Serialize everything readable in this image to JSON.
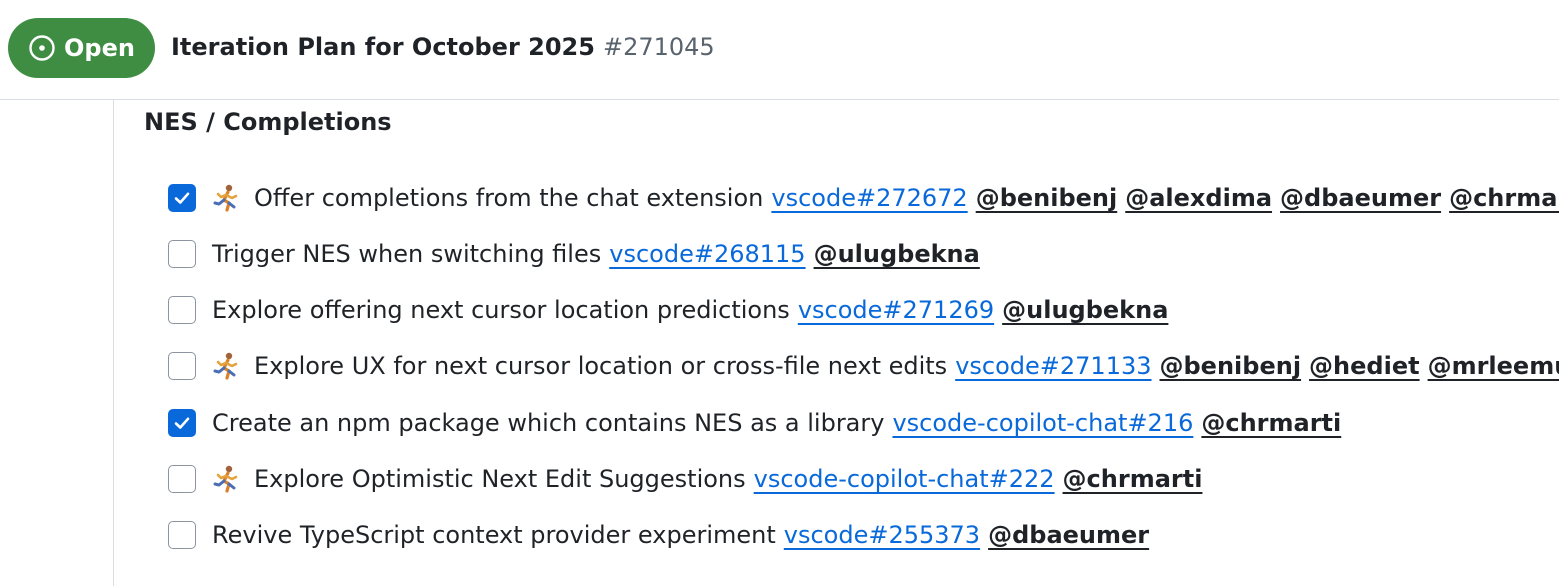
{
  "header": {
    "state_label": "Open",
    "state_icon": "issue-opened-icon",
    "state_color": "#3f8d43",
    "title": "Iteration Plan for October 2025",
    "number": "#271045"
  },
  "section": {
    "heading": "NES / Completions"
  },
  "colors": {
    "link": "#0969da",
    "checkbox_checked": "#0969da"
  },
  "tasks": [
    {
      "checked": true,
      "in_progress": true,
      "text": "Offer completions from the chat extension",
      "link": "vscode#272672",
      "mentions": [
        "@benibenj",
        "@alexdima",
        "@dbaeumer",
        "@chrmarti"
      ]
    },
    {
      "checked": false,
      "in_progress": false,
      "text": "Trigger NES when switching files",
      "link": "vscode#268115",
      "mentions": [
        "@ulugbekna"
      ]
    },
    {
      "checked": false,
      "in_progress": false,
      "text": "Explore offering next cursor location predictions",
      "link": "vscode#271269",
      "mentions": [
        "@ulugbekna"
      ]
    },
    {
      "checked": false,
      "in_progress": true,
      "text": "Explore UX for next cursor location or cross-file next edits",
      "link": "vscode#271133",
      "mentions": [
        "@benibenj",
        "@hediet",
        "@mrleemurray"
      ]
    },
    {
      "checked": true,
      "in_progress": false,
      "text": "Create an npm package which contains NES as a library",
      "link": "vscode-copilot-chat#216",
      "mentions": [
        "@chrmarti"
      ]
    },
    {
      "checked": false,
      "in_progress": true,
      "text": "Explore Optimistic Next Edit Suggestions",
      "link": "vscode-copilot-chat#222",
      "mentions": [
        "@chrmarti"
      ]
    },
    {
      "checked": false,
      "in_progress": false,
      "text": "Revive TypeScript context provider experiment",
      "link": "vscode#255373",
      "mentions": [
        "@dbaeumer"
      ]
    }
  ]
}
